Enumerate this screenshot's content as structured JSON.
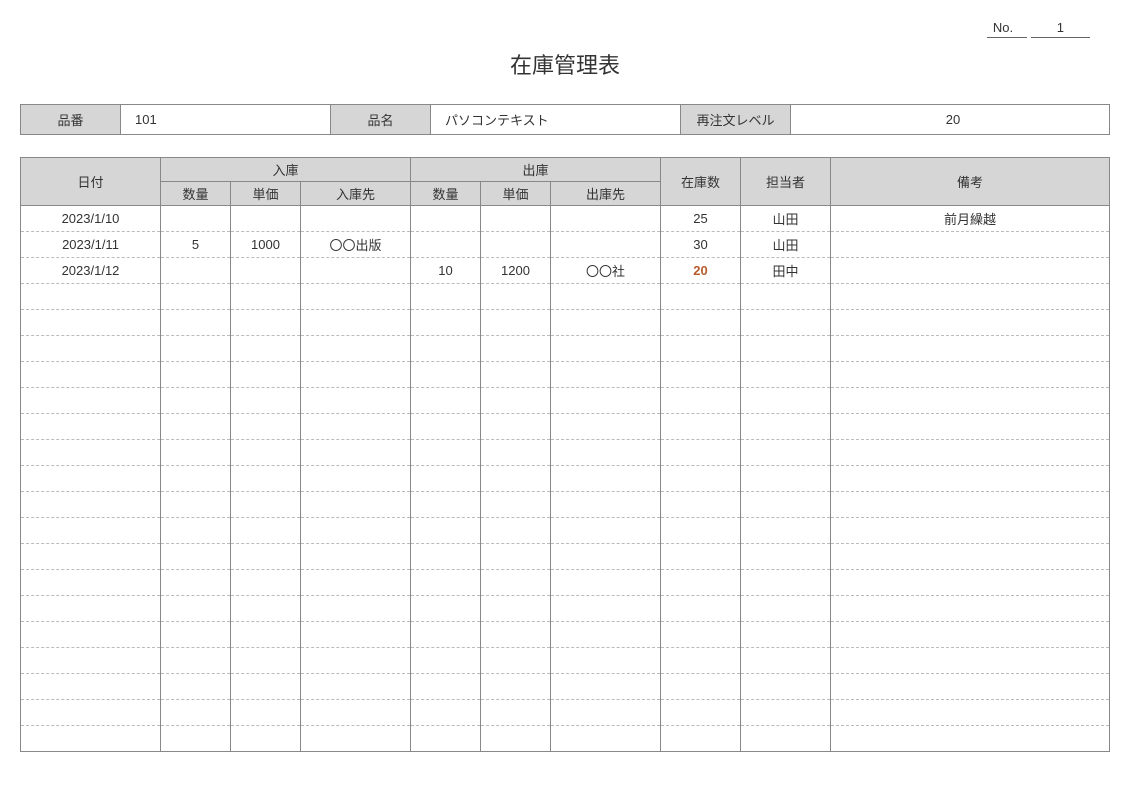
{
  "header": {
    "no_label": "No.",
    "no_value": "1",
    "title": "在庫管理表"
  },
  "info": {
    "code_label": "品番",
    "code_value": "101",
    "name_label": "品名",
    "name_value": "パソコンテキスト",
    "reorder_label": "再注文レベル",
    "reorder_value": "20"
  },
  "columns": {
    "date": "日付",
    "in": "入庫",
    "out": "出庫",
    "qty": "数量",
    "price": "単価",
    "in_src": "入庫先",
    "out_src": "出庫先",
    "stock": "在庫数",
    "person": "担当者",
    "remarks": "備考"
  },
  "rows": [
    {
      "date": "2023/1/10",
      "in_qty": "",
      "in_price": "",
      "in_src": "",
      "out_qty": "",
      "out_price": "",
      "out_src": "",
      "stock": "25",
      "person": "山田",
      "remarks": "前月繰越",
      "reorder_hit": false
    },
    {
      "date": "2023/1/11",
      "in_qty": "5",
      "in_price": "1000",
      "in_src": "〇〇出版",
      "out_qty": "",
      "out_price": "",
      "out_src": "",
      "stock": "30",
      "person": "山田",
      "remarks": "",
      "reorder_hit": false
    },
    {
      "date": "2023/1/12",
      "in_qty": "",
      "in_price": "",
      "in_src": "",
      "out_qty": "10",
      "out_price": "1200",
      "out_src": "〇〇社",
      "stock": "20",
      "person": "田中",
      "remarks": "",
      "reorder_hit": true
    }
  ],
  "empty_rows": 18
}
